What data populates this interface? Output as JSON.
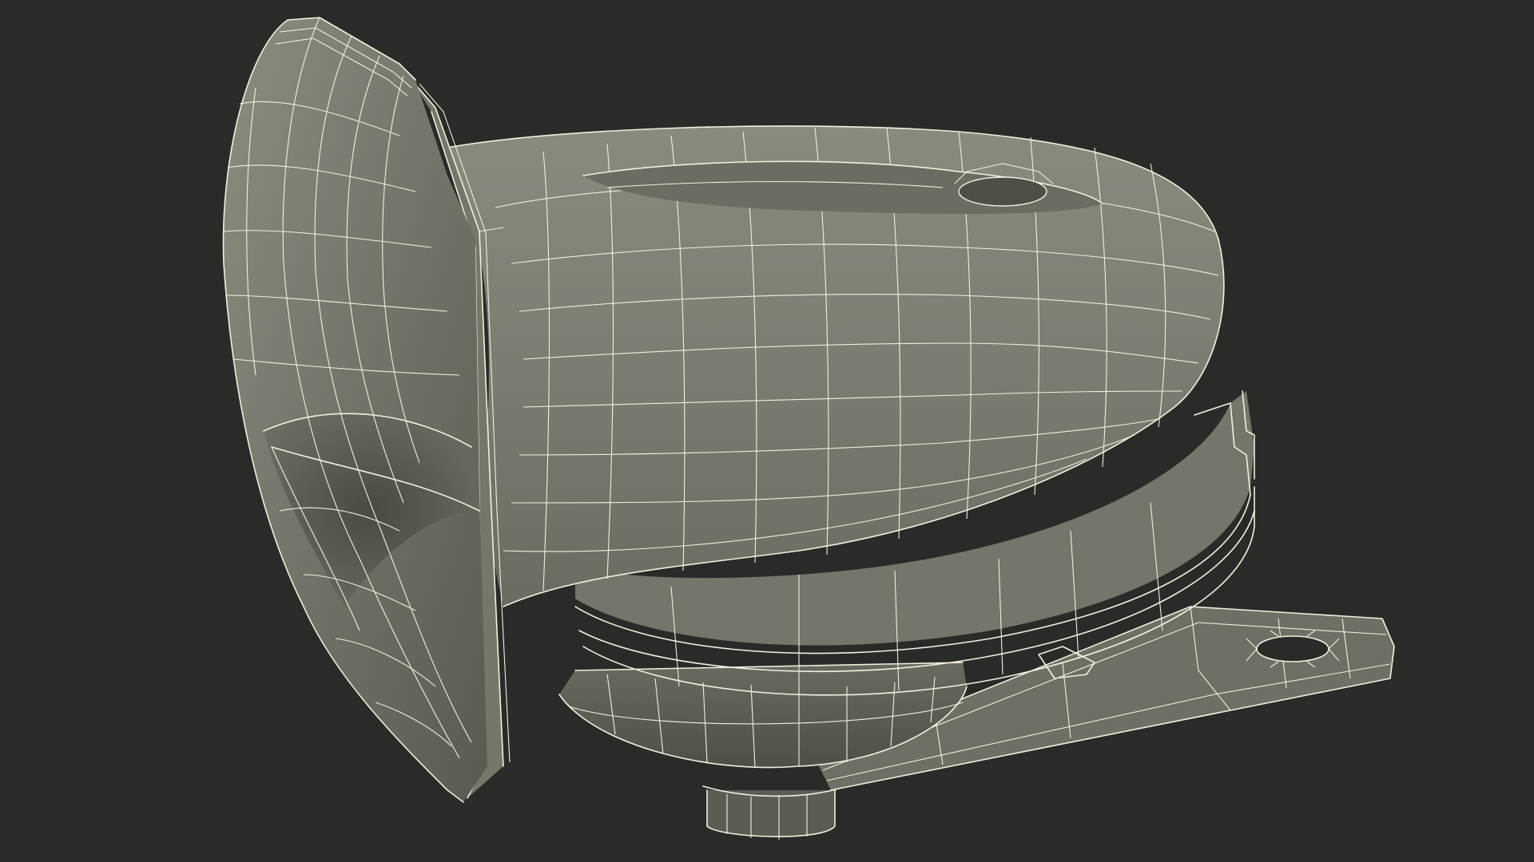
{
  "scene": {
    "subject": "",
    "colors": {
      "background": "#2a2a29",
      "surface": "#7b7b6e",
      "surface_dark": "#5f5f55",
      "surface_light": "#8e8e80",
      "wireframe": "#f2f0de"
    }
  }
}
